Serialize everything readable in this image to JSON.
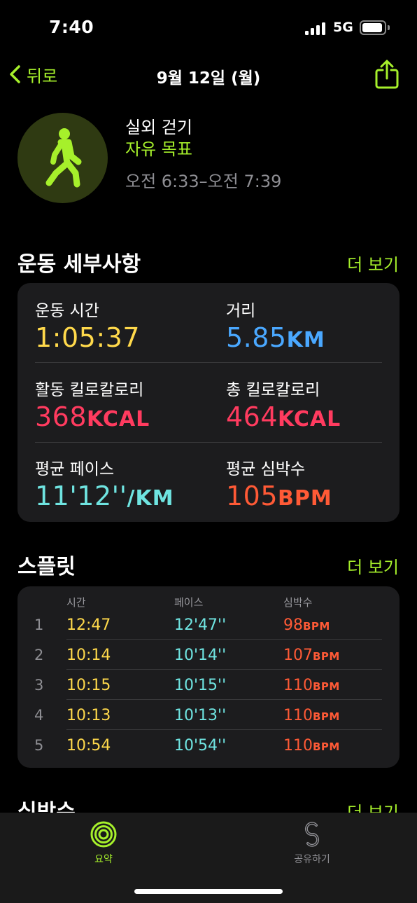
{
  "status": {
    "time": "7:40",
    "network": "5G"
  },
  "nav": {
    "back_label": "뒤로",
    "title": "9월 12일 (월)"
  },
  "workout": {
    "name": "실외 걷기",
    "goal": "자유 목표",
    "time_range": "오전 6:33–오전 7:39"
  },
  "details": {
    "title": "운동 세부사항",
    "more": "더 보기",
    "metrics": [
      {
        "label": "운동 시간",
        "value": "1:05:37",
        "unit": "",
        "color": "#ffd94b"
      },
      {
        "label": "거리",
        "value": "5.85",
        "unit": "KM",
        "color": "#4aa8ff"
      },
      {
        "label": "활동 킬로칼로리",
        "value": "368",
        "unit": "KCAL",
        "color": "#ff3b5f"
      },
      {
        "label": "총 킬로칼로리",
        "value": "464",
        "unit": "KCAL",
        "color": "#ff3b5f"
      },
      {
        "label": "평균 페이스",
        "value": "11'12''",
        "unit": "/KM",
        "color": "#6fe4e1"
      },
      {
        "label": "평균 심박수",
        "value": "105",
        "unit": "BPM",
        "color": "#ff5a36"
      }
    ]
  },
  "splits": {
    "title": "스플릿",
    "more": "더 보기",
    "headers": [
      "시간",
      "페이스",
      "심박수"
    ],
    "rows": [
      {
        "index": "1",
        "time": "12:47",
        "pace": "12'47''",
        "hr": "98",
        "hr_unit": "BPM"
      },
      {
        "index": "2",
        "time": "10:14",
        "pace": "10'14''",
        "hr": "107",
        "hr_unit": "BPM"
      },
      {
        "index": "3",
        "time": "10:15",
        "pace": "10'15''",
        "hr": "110",
        "hr_unit": "BPM"
      },
      {
        "index": "4",
        "time": "10:13",
        "pace": "10'13''",
        "hr": "110",
        "hr_unit": "BPM"
      },
      {
        "index": "5",
        "time": "10:54",
        "pace": "10'54''",
        "hr": "110",
        "hr_unit": "BPM"
      }
    ]
  },
  "heart": {
    "title": "심박수",
    "more": "더 보기"
  },
  "tabs": [
    {
      "label": "요약",
      "icon": "activity-rings-icon",
      "active": true,
      "color": "#a6f02b"
    },
    {
      "label": "공유하기",
      "icon": "sharing-icon",
      "active": false,
      "color": "#8e8e93"
    }
  ]
}
